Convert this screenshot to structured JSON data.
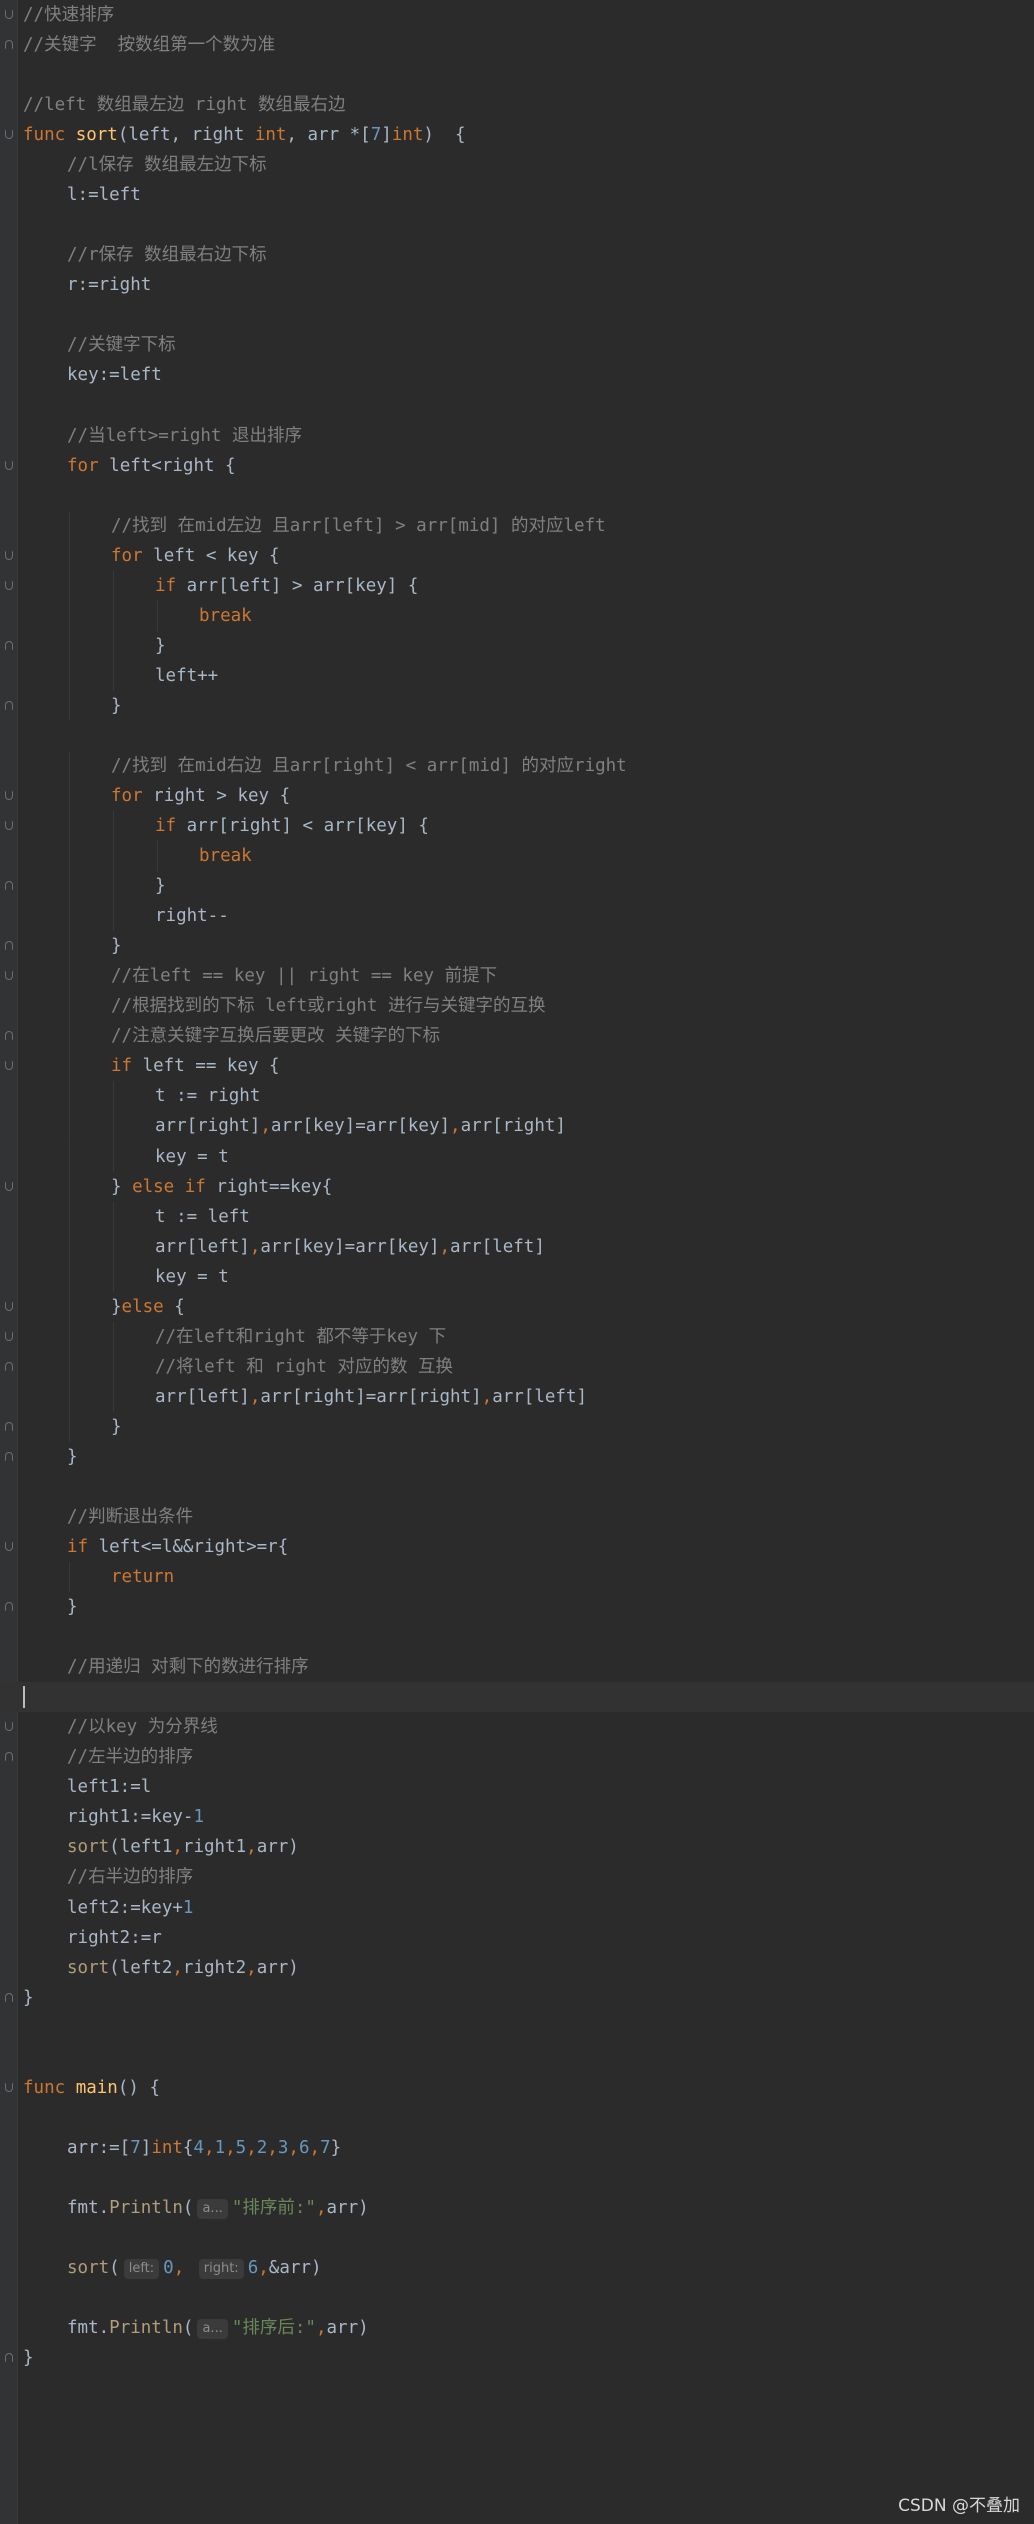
{
  "editor": {
    "language": "go",
    "colors": {
      "background": "#2b2b2b",
      "keyword": "#cc7832",
      "function": "#ffc66d",
      "comment": "#808080",
      "number": "#6897bb",
      "string": "#6a8759",
      "plain": "#a9b7c6",
      "hint_background": "#3b3b3b"
    },
    "lines": [
      {
        "indent": 0,
        "fold": "open",
        "tokens": [
          {
            "t": "cm",
            "v": "//快速排序"
          }
        ]
      },
      {
        "indent": 0,
        "fold": "close",
        "tokens": [
          {
            "t": "cm",
            "v": "//关键字  按数组第一个数为准"
          }
        ]
      },
      {
        "indent": 0,
        "tokens": []
      },
      {
        "indent": 0,
        "tokens": [
          {
            "t": "cm",
            "v": "//left 数组最左边 right 数组最右边"
          }
        ]
      },
      {
        "indent": 0,
        "fold": "open",
        "tokens": [
          {
            "t": "kw",
            "v": "func "
          },
          {
            "t": "fn",
            "v": "sort"
          },
          {
            "t": "pl",
            "v": "(left, right "
          },
          {
            "t": "kw",
            "v": "int"
          },
          {
            "t": "pl",
            "v": ", arr *["
          },
          {
            "t": "num",
            "v": "7"
          },
          {
            "t": "pl",
            "v": "]"
          },
          {
            "t": "kw",
            "v": "int"
          },
          {
            "t": "pl",
            "v": ")  {"
          }
        ]
      },
      {
        "indent": 1,
        "tokens": [
          {
            "t": "cm",
            "v": "//l保存 数组最左边下标"
          }
        ]
      },
      {
        "indent": 1,
        "tokens": [
          {
            "t": "pl",
            "v": "l:=left"
          }
        ]
      },
      {
        "indent": 0,
        "tokens": []
      },
      {
        "indent": 1,
        "tokens": [
          {
            "t": "cm",
            "v": "//r保存 数组最右边下标"
          }
        ]
      },
      {
        "indent": 1,
        "tokens": [
          {
            "t": "pl",
            "v": "r:=right"
          }
        ]
      },
      {
        "indent": 0,
        "tokens": []
      },
      {
        "indent": 1,
        "tokens": [
          {
            "t": "cm",
            "v": "//关键字下标"
          }
        ]
      },
      {
        "indent": 1,
        "tokens": [
          {
            "t": "pl",
            "v": "key:=left"
          }
        ]
      },
      {
        "indent": 0,
        "tokens": []
      },
      {
        "indent": 1,
        "tokens": [
          {
            "t": "cm",
            "v": "//当left>=right 退出排序"
          }
        ]
      },
      {
        "indent": 1,
        "fold": "open",
        "tokens": [
          {
            "t": "kw",
            "v": "for "
          },
          {
            "t": "pl",
            "v": "left<right {"
          }
        ]
      },
      {
        "indent": 0,
        "tokens": []
      },
      {
        "indent": 2,
        "tokens": [
          {
            "t": "cm",
            "v": "//找到 在mid左边 且arr[left] > arr[mid] 的对应left"
          }
        ]
      },
      {
        "indent": 2,
        "fold": "open",
        "tokens": [
          {
            "t": "kw",
            "v": "for "
          },
          {
            "t": "pl",
            "v": "left < key {"
          }
        ]
      },
      {
        "indent": 3,
        "fold": "open",
        "tokens": [
          {
            "t": "kw",
            "v": "if "
          },
          {
            "t": "pl",
            "v": "arr[left] > arr[key] {"
          }
        ]
      },
      {
        "indent": 4,
        "tokens": [
          {
            "t": "kw",
            "v": "break"
          }
        ]
      },
      {
        "indent": 3,
        "fold": "close",
        "tokens": [
          {
            "t": "pl",
            "v": "}"
          }
        ]
      },
      {
        "indent": 3,
        "tokens": [
          {
            "t": "pl",
            "v": "left++"
          }
        ]
      },
      {
        "indent": 2,
        "fold": "close",
        "tokens": [
          {
            "t": "pl",
            "v": "}"
          }
        ]
      },
      {
        "indent": 0,
        "tokens": []
      },
      {
        "indent": 2,
        "tokens": [
          {
            "t": "cm",
            "v": "//找到 在mid右边 且arr[right] < arr[mid] 的对应right"
          }
        ]
      },
      {
        "indent": 2,
        "fold": "open",
        "tokens": [
          {
            "t": "kw",
            "v": "for "
          },
          {
            "t": "pl",
            "v": "right > key {"
          }
        ]
      },
      {
        "indent": 3,
        "fold": "open",
        "tokens": [
          {
            "t": "kw",
            "v": "if "
          },
          {
            "t": "pl",
            "v": "arr[right] < arr[key] {"
          }
        ]
      },
      {
        "indent": 4,
        "tokens": [
          {
            "t": "kw",
            "v": "break"
          }
        ]
      },
      {
        "indent": 3,
        "fold": "close",
        "tokens": [
          {
            "t": "pl",
            "v": "}"
          }
        ]
      },
      {
        "indent": 3,
        "tokens": [
          {
            "t": "pl",
            "v": "right--"
          }
        ]
      },
      {
        "indent": 2,
        "fold": "close",
        "tokens": [
          {
            "t": "pl",
            "v": "}"
          }
        ]
      },
      {
        "indent": 2,
        "fold": "open",
        "tokens": [
          {
            "t": "cm",
            "v": "//在left == key || right == key 前提下"
          }
        ]
      },
      {
        "indent": 2,
        "tokens": [
          {
            "t": "cm",
            "v": "//根据找到的下标 left或right 进行与关键字的互换"
          }
        ]
      },
      {
        "indent": 2,
        "fold": "close",
        "tokens": [
          {
            "t": "cm",
            "v": "//注意关键字互换后要更改 关键字的下标"
          }
        ]
      },
      {
        "indent": 2,
        "fold": "open",
        "tokens": [
          {
            "t": "kw",
            "v": "if "
          },
          {
            "t": "pl",
            "v": "left == key {"
          }
        ]
      },
      {
        "indent": 3,
        "tokens": [
          {
            "t": "pl",
            "v": "t := right"
          }
        ]
      },
      {
        "indent": 3,
        "tokens": [
          {
            "t": "pl",
            "v": "arr[right]"
          },
          {
            "t": "kw",
            "v": ","
          },
          {
            "t": "pl",
            "v": "arr[key]=arr[key]"
          },
          {
            "t": "kw",
            "v": ","
          },
          {
            "t": "pl",
            "v": "arr[right]"
          }
        ]
      },
      {
        "indent": 3,
        "tokens": [
          {
            "t": "pl",
            "v": "key = t"
          }
        ]
      },
      {
        "indent": 2,
        "fold": "open",
        "tokens": [
          {
            "t": "pl",
            "v": "} "
          },
          {
            "t": "kw",
            "v": "else if "
          },
          {
            "t": "pl",
            "v": "right==key{"
          }
        ]
      },
      {
        "indent": 3,
        "tokens": [
          {
            "t": "pl",
            "v": "t := left"
          }
        ]
      },
      {
        "indent": 3,
        "tokens": [
          {
            "t": "pl",
            "v": "arr[left]"
          },
          {
            "t": "kw",
            "v": ","
          },
          {
            "t": "pl",
            "v": "arr[key]=arr[key]"
          },
          {
            "t": "kw",
            "v": ","
          },
          {
            "t": "pl",
            "v": "arr[left]"
          }
        ]
      },
      {
        "indent": 3,
        "tokens": [
          {
            "t": "pl",
            "v": "key = t"
          }
        ]
      },
      {
        "indent": 2,
        "fold": "open",
        "tokens": [
          {
            "t": "pl",
            "v": "}"
          },
          {
            "t": "kw",
            "v": "else "
          },
          {
            "t": "pl",
            "v": "{"
          }
        ]
      },
      {
        "indent": 3,
        "fold": "open",
        "tokens": [
          {
            "t": "cm",
            "v": "//在left和right 都不等于key 下"
          }
        ]
      },
      {
        "indent": 3,
        "fold": "close",
        "tokens": [
          {
            "t": "cm",
            "v": "//将left 和 right 对应的数 互换"
          }
        ]
      },
      {
        "indent": 3,
        "tokens": [
          {
            "t": "pl",
            "v": "arr[left]"
          },
          {
            "t": "kw",
            "v": ","
          },
          {
            "t": "pl",
            "v": "arr[right]=arr[right]"
          },
          {
            "t": "kw",
            "v": ","
          },
          {
            "t": "pl",
            "v": "arr[left]"
          }
        ]
      },
      {
        "indent": 2,
        "fold": "close",
        "tokens": [
          {
            "t": "pl",
            "v": "}"
          }
        ]
      },
      {
        "indent": 1,
        "fold": "close",
        "tokens": [
          {
            "t": "pl",
            "v": "}"
          }
        ]
      },
      {
        "indent": 0,
        "tokens": []
      },
      {
        "indent": 1,
        "tokens": [
          {
            "t": "cm",
            "v": "//判断退出条件"
          }
        ]
      },
      {
        "indent": 1,
        "fold": "open",
        "tokens": [
          {
            "t": "kw",
            "v": "if "
          },
          {
            "t": "pl",
            "v": "left<=l&&right>=r{"
          }
        ]
      },
      {
        "indent": 2,
        "tokens": [
          {
            "t": "kw",
            "v": "return"
          }
        ]
      },
      {
        "indent": 1,
        "fold": "close",
        "tokens": [
          {
            "t": "pl",
            "v": "}"
          }
        ]
      },
      {
        "indent": 0,
        "tokens": []
      },
      {
        "indent": 1,
        "tokens": [
          {
            "t": "cm",
            "v": "//用递归 对剩下的数进行排序"
          }
        ]
      },
      {
        "indent": 0,
        "current": true,
        "caret": true,
        "tokens": []
      },
      {
        "indent": 1,
        "fold": "open",
        "tokens": [
          {
            "t": "cm",
            "v": "//以key 为分界线"
          }
        ]
      },
      {
        "indent": 1,
        "fold": "close",
        "tokens": [
          {
            "t": "cm",
            "v": "//左半边的排序"
          }
        ]
      },
      {
        "indent": 1,
        "tokens": [
          {
            "t": "pl",
            "v": "left1:=l"
          }
        ]
      },
      {
        "indent": 1,
        "tokens": [
          {
            "t": "pl",
            "v": "right1:=key-"
          },
          {
            "t": "num",
            "v": "1"
          }
        ]
      },
      {
        "indent": 1,
        "tokens": [
          {
            "t": "call",
            "v": "sort"
          },
          {
            "t": "pl",
            "v": "(left1"
          },
          {
            "t": "kw",
            "v": ","
          },
          {
            "t": "pl",
            "v": "right1"
          },
          {
            "t": "kw",
            "v": ","
          },
          {
            "t": "pl",
            "v": "arr)"
          }
        ]
      },
      {
        "indent": 1,
        "tokens": [
          {
            "t": "cm",
            "v": "//右半边的排序"
          }
        ]
      },
      {
        "indent": 1,
        "tokens": [
          {
            "t": "pl",
            "v": "left2:=key+"
          },
          {
            "t": "num",
            "v": "1"
          }
        ]
      },
      {
        "indent": 1,
        "tokens": [
          {
            "t": "pl",
            "v": "right2:=r"
          }
        ]
      },
      {
        "indent": 1,
        "tokens": [
          {
            "t": "call",
            "v": "sort"
          },
          {
            "t": "pl",
            "v": "(left2"
          },
          {
            "t": "kw",
            "v": ","
          },
          {
            "t": "pl",
            "v": "right2"
          },
          {
            "t": "kw",
            "v": ","
          },
          {
            "t": "pl",
            "v": "arr)"
          }
        ]
      },
      {
        "indent": 0,
        "fold": "close",
        "tokens": [
          {
            "t": "pl",
            "v": "}"
          }
        ]
      },
      {
        "indent": 0,
        "tokens": []
      },
      {
        "indent": 0,
        "tokens": []
      },
      {
        "indent": 0,
        "fold": "open",
        "tokens": [
          {
            "t": "kw",
            "v": "func "
          },
          {
            "t": "fn",
            "v": "main"
          },
          {
            "t": "pl",
            "v": "() {"
          }
        ]
      },
      {
        "indent": 0,
        "tokens": []
      },
      {
        "indent": 1,
        "tokens": [
          {
            "t": "pl",
            "v": "arr:=["
          },
          {
            "t": "num",
            "v": "7"
          },
          {
            "t": "pl",
            "v": "]"
          },
          {
            "t": "kw",
            "v": "int"
          },
          {
            "t": "pl",
            "v": "{"
          },
          {
            "t": "num",
            "v": "4"
          },
          {
            "t": "kw",
            "v": ","
          },
          {
            "t": "num",
            "v": "1"
          },
          {
            "t": "kw",
            "v": ","
          },
          {
            "t": "num",
            "v": "5"
          },
          {
            "t": "kw",
            "v": ","
          },
          {
            "t": "num",
            "v": "2"
          },
          {
            "t": "kw",
            "v": ","
          },
          {
            "t": "num",
            "v": "3"
          },
          {
            "t": "kw",
            "v": ","
          },
          {
            "t": "num",
            "v": "6"
          },
          {
            "t": "kw",
            "v": ","
          },
          {
            "t": "num",
            "v": "7"
          },
          {
            "t": "pl",
            "v": "}"
          }
        ]
      },
      {
        "indent": 0,
        "tokens": []
      },
      {
        "indent": 1,
        "tokens": [
          {
            "t": "pkg",
            "v": "fmt."
          },
          {
            "t": "call",
            "v": "Println"
          },
          {
            "t": "pl",
            "v": "("
          },
          {
            "t": "hint",
            "v": "a..."
          },
          {
            "t": "str",
            "v": "\"排序前:\""
          },
          {
            "t": "kw",
            "v": ","
          },
          {
            "t": "pl",
            "v": "arr)"
          }
        ]
      },
      {
        "indent": 0,
        "tokens": []
      },
      {
        "indent": 1,
        "tokens": [
          {
            "t": "call",
            "v": "sort"
          },
          {
            "t": "pl",
            "v": "("
          },
          {
            "t": "hint",
            "v": "left:"
          },
          {
            "t": "num",
            "v": "0"
          },
          {
            "t": "kw",
            "v": ", "
          },
          {
            "t": "hint",
            "v": "right:"
          },
          {
            "t": "num",
            "v": "6"
          },
          {
            "t": "kw",
            "v": ","
          },
          {
            "t": "pl",
            "v": "&arr)"
          }
        ]
      },
      {
        "indent": 0,
        "tokens": []
      },
      {
        "indent": 1,
        "tokens": [
          {
            "t": "pkg",
            "v": "fmt."
          },
          {
            "t": "call",
            "v": "Println"
          },
          {
            "t": "pl",
            "v": "("
          },
          {
            "t": "hint",
            "v": "a..."
          },
          {
            "t": "str",
            "v": "\"排序后:\""
          },
          {
            "t": "kw",
            "v": ","
          },
          {
            "t": "pl",
            "v": "arr)"
          }
        ]
      },
      {
        "indent": 0,
        "fold": "close",
        "tokens": [
          {
            "t": "pl",
            "v": "}"
          }
        ]
      }
    ]
  },
  "watermark": "CSDN @不叠加"
}
